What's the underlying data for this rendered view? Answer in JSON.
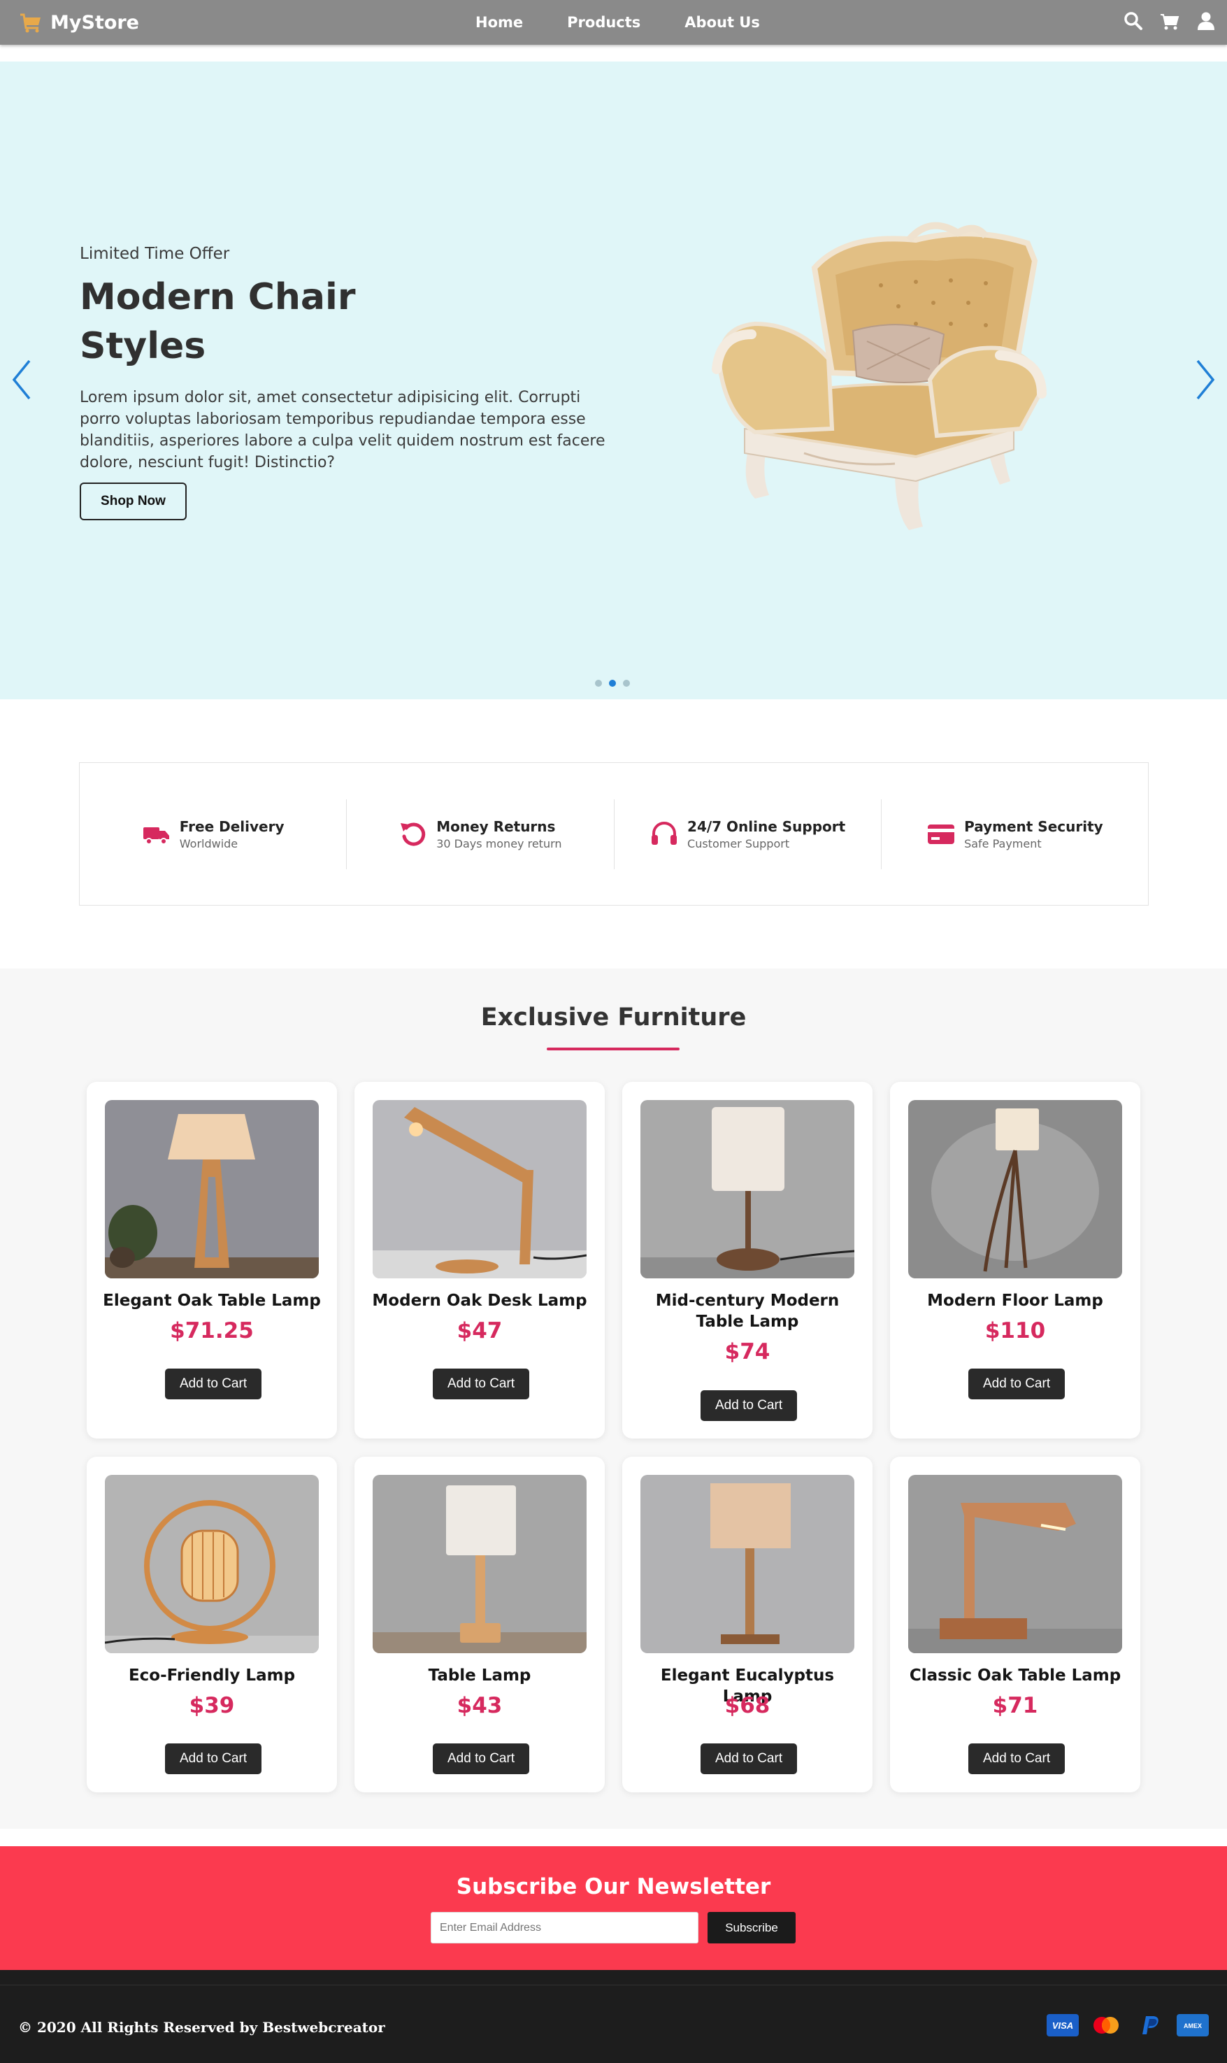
{
  "nav": {
    "brand": "MyStore",
    "links": [
      "Home",
      "Products",
      "About Us"
    ],
    "icons": [
      "search-icon",
      "cart-icon",
      "user-icon"
    ]
  },
  "hero": {
    "kicker": "Limited Time Offer",
    "title": "Modern Chair Styles",
    "text": "Lorem ipsum dolor sit, amet consectetur adipisicing elit. Corrupti porro voluptas laboriosam temporibus repudiandae tempora esse blanditiis, asperiores labore a culpa velit quidem nostrum est facere dolore, nesciunt fugit! Distinctio?",
    "button": "Shop Now",
    "slides": 3,
    "active_slide": 2
  },
  "features": [
    {
      "title": "Free Delivery",
      "sub": "Worldwide",
      "icon": "truck-icon"
    },
    {
      "title": "Money Returns",
      "sub": "30 Days money return",
      "icon": "return-icon"
    },
    {
      "title": "24/7 Online Support",
      "sub": "Customer Support",
      "icon": "headset-icon"
    },
    {
      "title": "Payment Security",
      "sub": "Safe Payment",
      "icon": "credit-card-icon"
    }
  ],
  "section": {
    "title": "Exclusive Furniture"
  },
  "products": [
    {
      "name": "Elegant Oak Table Lamp",
      "price": "$71.25",
      "button": "Add to Cart"
    },
    {
      "name": "Modern Oak Desk Lamp",
      "price": "$47",
      "button": "Add to Cart"
    },
    {
      "name": "Mid-century Modern Table Lamp",
      "price": "$74",
      "button": "Add to Cart"
    },
    {
      "name": "Modern Floor Lamp",
      "price": "$110",
      "button": "Add to Cart"
    },
    {
      "name": "Eco-Friendly Lamp",
      "price": "$39",
      "button": "Add to Cart"
    },
    {
      "name": "Table Lamp",
      "price": "$43",
      "button": "Add to Cart"
    },
    {
      "name": "Elegant Eucalyptus Lamp",
      "price": "$68",
      "button": "Add to Cart"
    },
    {
      "name": "Classic Oak Table Lamp",
      "price": "$71",
      "button": "Add to Cart"
    }
  ],
  "newsletter": {
    "title": "Subscribe Our Newsletter",
    "placeholder": "Enter Email Address",
    "button": "Subscribe"
  },
  "footer": {
    "copyright": "© 2020 All Rights Reserved by Bestwebcreator",
    "payment_icons": [
      "visa-icon",
      "mastercard-icon",
      "paypal-icon",
      "amex-icon"
    ],
    "visa_text": "VISA",
    "amex_text": "AMEX"
  },
  "colors": {
    "accent": "#d6295e",
    "nav_bg": "#8a8a8a",
    "hero_bg": "#e0f6f8",
    "newsletter_bg": "#fb3a4f",
    "footer_bg": "#1d1d1d"
  }
}
